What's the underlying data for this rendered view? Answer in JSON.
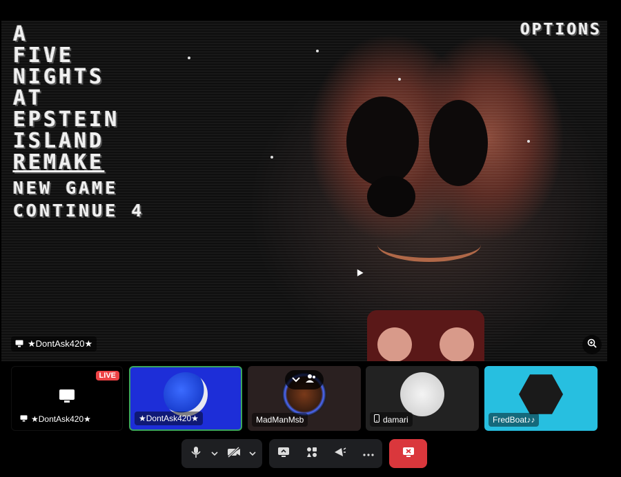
{
  "stream": {
    "title_lines": [
      "A",
      "FIVE",
      "NIGHTS",
      "AT",
      "EPSTEIN",
      "ISLAND"
    ],
    "title_underlined": "REMAKE",
    "menu": [
      {
        "label": "NEW GAME"
      },
      {
        "label": "CONTINUE 4"
      }
    ],
    "options_label": "OPTIONS",
    "streamer_label": "★DontAsk420★"
  },
  "tiles": [
    {
      "name": "★DontAsk420★",
      "badge": "LIVE",
      "icon": "screen-share-icon"
    },
    {
      "name": "★DontAsk420★",
      "icon": "avatar"
    },
    {
      "name": "MadManMsb",
      "icon": "avatar"
    },
    {
      "name": "damari",
      "icon": "mobile-icon"
    },
    {
      "name": "FredBoat♪♪",
      "icon": "avatar"
    }
  ],
  "controls": {
    "microphone": "microphone-icon",
    "camera": "camera-off-icon",
    "share_screen": "screen-share-icon",
    "activities": "activities-icon",
    "soundboard": "soundboard-icon",
    "more": "more-icon",
    "leave": "leave-call-icon"
  },
  "colors": {
    "live_badge": "#ed4245",
    "speaking_border": "#3ba55d",
    "leave_button": "#da373c",
    "fredboat_bg": "#27bfe0",
    "sonic_bg": "#1d2ed8"
  }
}
